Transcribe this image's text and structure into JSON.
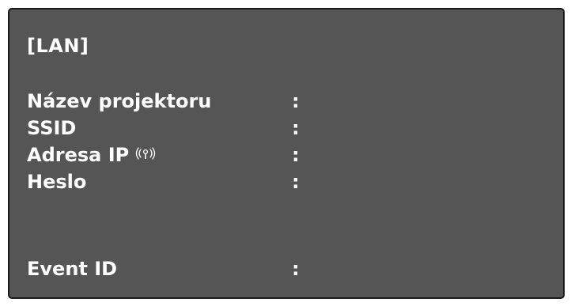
{
  "screen": {
    "title": "[LAN]",
    "rows": [
      {
        "label": "Název projektoru",
        "separator": ":",
        "value": ""
      },
      {
        "label": "SSID",
        "separator": ":",
        "value": ""
      },
      {
        "label": "Adresa IP",
        "separator": ":",
        "value": "",
        "icon": "wireless-signal-icon"
      },
      {
        "label": "Heslo",
        "separator": ":",
        "value": ""
      },
      {
        "label": "Event ID",
        "separator": ":",
        "value": ""
      }
    ]
  },
  "colors": {
    "background": "#555555",
    "border": "#1a1a1a",
    "text": "#ffffff"
  }
}
